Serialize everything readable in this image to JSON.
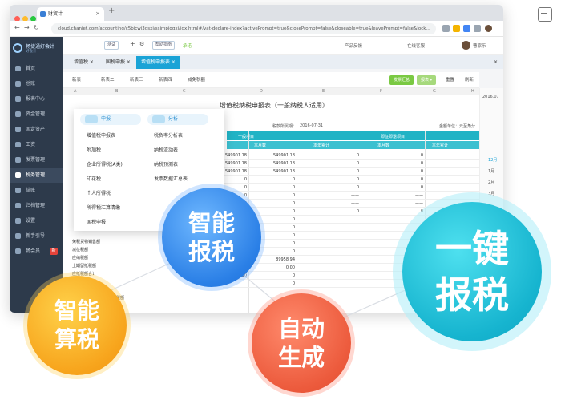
{
  "browser": {
    "tab_title": "财贸计",
    "url": "cloud.chanjet.com/accounting/c5bicwi3dsxj/ssjmpiqgxi/idx.html#/vat-declare-index?activePrompt=true&closePrompt=false&closeable=true&leavePrompt=false&lock..."
  },
  "sidebar": {
    "logo": "畅捷通好会计",
    "logo_sub": "好会计",
    "items": [
      {
        "label": "首页"
      },
      {
        "label": "总账"
      },
      {
        "label": "报表中心"
      },
      {
        "label": "资金管理"
      },
      {
        "label": "固定资产"
      },
      {
        "label": "工资"
      },
      {
        "label": "发票管理"
      },
      {
        "label": "税务管理"
      },
      {
        "label": "结账"
      },
      {
        "label": "归档管理"
      },
      {
        "label": "设置"
      },
      {
        "label": "新手引导"
      },
      {
        "label": "畅会员",
        "badge": "新"
      }
    ]
  },
  "topbar": {
    "company_select": "测试",
    "help": "帮助指南",
    "service": "产品反馈",
    "online": "在线客服",
    "user": "曹家乐",
    "right_text": "承诺"
  },
  "module_tabs": [
    {
      "label": "增值税 ×"
    },
    {
      "label": "国税申报 ×"
    },
    {
      "label": "增值税申报表 ×",
      "active": true
    }
  ],
  "toolbar": {
    "buttons": [
      "新表一",
      "新表二",
      "新表三",
      "新表四",
      "减免税额"
    ],
    "green1": "发票汇总",
    "green2": "报表 ▾",
    "reset": "重置",
    "refresh": "刷新"
  },
  "sheet": {
    "columns": [
      "A",
      "B",
      "C",
      "D",
      "E",
      "F",
      "G",
      "H"
    ],
    "title": "增值税纳税申报表（一般纳税人适用）",
    "period_label": "税款所属期：",
    "period_value": "2016-07-31",
    "unit_label": "金额单位：元至角分",
    "band1": "一般项目",
    "band2": "即征即退项目",
    "sub1": "本月数",
    "sub2": "本年累计",
    "sub3": "本月数",
    "sub4": "本年累计",
    "left_rows": [
      "免税货物销售额",
      "减征税额",
      "应纳税额",
      "上期留抵税额",
      "应抵税额合计",
      "实际抵扣税额",
      "应纳税额减征额",
      "一般计税方法计算的应纳税额",
      "期末留抵税额（期末余额）"
    ],
    "values_col1": [
      "549901.18",
      "549901.18",
      "549901.18",
      "0",
      "0",
      "0",
      "0",
      "0",
      "0",
      "0",
      "0",
      "0",
      "0",
      "0",
      "10",
      "10"
    ],
    "values_col2": [
      "549901.18",
      "549901.18",
      "549901.18",
      "0",
      "0",
      "0",
      "0",
      "0",
      "0",
      "0",
      "0",
      "0",
      "0",
      "89958.94",
      "0.00",
      "0",
      "0"
    ],
    "values_col3": [
      "0",
      "0",
      "0",
      "0",
      "0",
      "——",
      "——",
      "0"
    ],
    "values_col4": [
      "0",
      "0",
      "0",
      "0",
      "0",
      "——",
      "——",
      "0"
    ]
  },
  "right_panel": {
    "date": "2016.07",
    "items": [
      "12月",
      "1月",
      "2月",
      "3月"
    ]
  },
  "dropdown": {
    "head1": "申报",
    "head2": "分析",
    "col1": [
      "增值税申报表",
      "附加税",
      "企业所得税(A类)",
      "印花税",
      "个人所得税",
      "所得税汇算清缴",
      "国税申报"
    ],
    "col2": [
      "税负率分析表",
      "纳税流动表",
      "纳税预测表",
      "发票数据汇总表"
    ]
  },
  "bubbles": {
    "smart_calc": [
      "智能",
      "算税"
    ],
    "smart_report": [
      "智能",
      "报税"
    ],
    "auto_gen": [
      "自动",
      "生成"
    ],
    "one_key": [
      "一键",
      "报税"
    ]
  },
  "colors": {
    "yellow": "#f7a41c",
    "blue": "#2a7fe6",
    "red": "#ec5a3c",
    "cyan": "#16b4cf",
    "sidebar": "#2d3a4b",
    "teal_band": "#21b3c5",
    "green": "#7ac943"
  }
}
